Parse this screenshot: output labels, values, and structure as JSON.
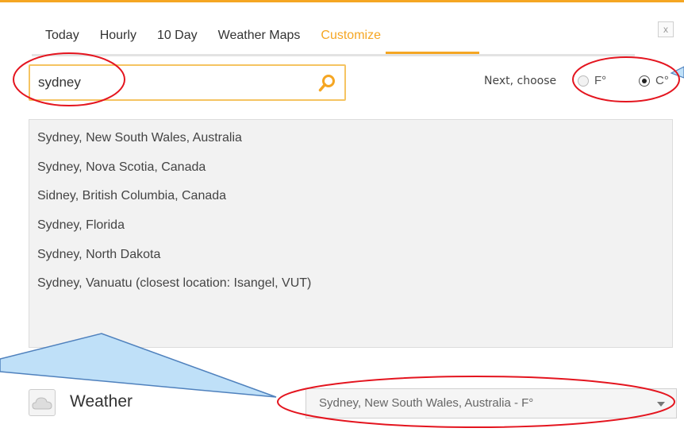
{
  "tabs": [
    {
      "label": "Today",
      "active": false
    },
    {
      "label": "Hourly",
      "active": false
    },
    {
      "label": "10 Day",
      "active": false
    },
    {
      "label": "Weather Maps",
      "active": false
    },
    {
      "label": "Customize",
      "active": true
    }
  ],
  "close": {
    "label": "x"
  },
  "search": {
    "value": "sydney",
    "icon": "search-icon"
  },
  "units": {
    "prompt": "Next, choose",
    "options": [
      {
        "label": "F°",
        "checked": false
      },
      {
        "label": "C°",
        "checked": true
      }
    ]
  },
  "results": [
    "Sydney, New South Wales, Australia",
    "Sydney, Nova Scotia, Canada",
    "Sidney, British Columbia, Canada",
    "Sydney, Florida",
    "Sydney, North Dakota",
    "Sydney, Vanuatu (closest location: Isangel, VUT)"
  ],
  "footer": {
    "title": "Weather",
    "selected_location": "Sydney, New South Wales, Australia - F°"
  },
  "colors": {
    "accent": "#f5a623",
    "annotation": "#e4151f",
    "callout": "#bfe0f8"
  }
}
